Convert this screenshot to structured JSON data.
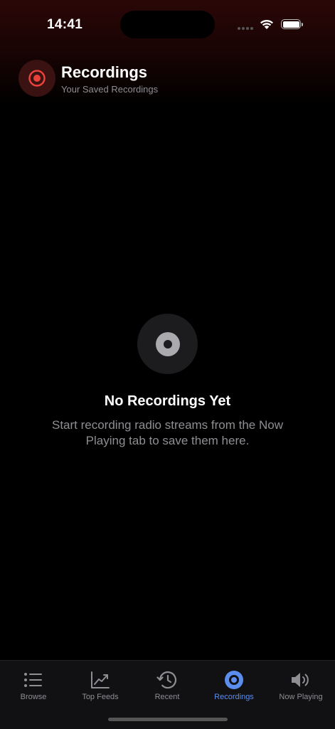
{
  "status_bar": {
    "time": "14:41",
    "icons": [
      "signal-icon",
      "wifi-icon",
      "battery-icon"
    ]
  },
  "header": {
    "title": "Recordings",
    "subtitle": "Your Saved Recordings",
    "icon": "record-icon",
    "accent_color": "#e8423a"
  },
  "empty_state": {
    "icon": "disc-icon",
    "title": "No Recordings Yet",
    "message": "Start recording radio streams from the Now Playing tab to save them here."
  },
  "tab_bar": {
    "active_color": "#5a8dee",
    "inactive_color": "#8e8e93",
    "tabs": [
      {
        "label": "Browse",
        "icon": "list-icon",
        "active": false
      },
      {
        "label": "Top Feeds",
        "icon": "chart-trend-icon",
        "active": false
      },
      {
        "label": "Recent",
        "icon": "history-icon",
        "active": false
      },
      {
        "label": "Recordings",
        "icon": "record-icon",
        "active": true
      },
      {
        "label": "Now Playing",
        "icon": "speaker-icon",
        "active": false
      }
    ]
  }
}
